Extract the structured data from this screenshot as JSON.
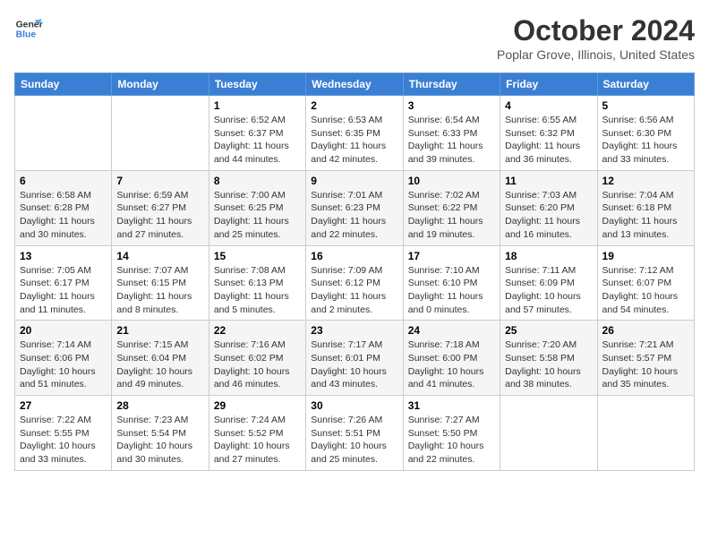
{
  "header": {
    "logo_line1": "General",
    "logo_line2": "Blue",
    "month": "October 2024",
    "location": "Poplar Grove, Illinois, United States"
  },
  "weekdays": [
    "Sunday",
    "Monday",
    "Tuesday",
    "Wednesday",
    "Thursday",
    "Friday",
    "Saturday"
  ],
  "weeks": [
    [
      {
        "day": "",
        "info": ""
      },
      {
        "day": "",
        "info": ""
      },
      {
        "day": "1",
        "info": "Sunrise: 6:52 AM\nSunset: 6:37 PM\nDaylight: 11 hours and 44 minutes."
      },
      {
        "day": "2",
        "info": "Sunrise: 6:53 AM\nSunset: 6:35 PM\nDaylight: 11 hours and 42 minutes."
      },
      {
        "day": "3",
        "info": "Sunrise: 6:54 AM\nSunset: 6:33 PM\nDaylight: 11 hours and 39 minutes."
      },
      {
        "day": "4",
        "info": "Sunrise: 6:55 AM\nSunset: 6:32 PM\nDaylight: 11 hours and 36 minutes."
      },
      {
        "day": "5",
        "info": "Sunrise: 6:56 AM\nSunset: 6:30 PM\nDaylight: 11 hours and 33 minutes."
      }
    ],
    [
      {
        "day": "6",
        "info": "Sunrise: 6:58 AM\nSunset: 6:28 PM\nDaylight: 11 hours and 30 minutes."
      },
      {
        "day": "7",
        "info": "Sunrise: 6:59 AM\nSunset: 6:27 PM\nDaylight: 11 hours and 27 minutes."
      },
      {
        "day": "8",
        "info": "Sunrise: 7:00 AM\nSunset: 6:25 PM\nDaylight: 11 hours and 25 minutes."
      },
      {
        "day": "9",
        "info": "Sunrise: 7:01 AM\nSunset: 6:23 PM\nDaylight: 11 hours and 22 minutes."
      },
      {
        "day": "10",
        "info": "Sunrise: 7:02 AM\nSunset: 6:22 PM\nDaylight: 11 hours and 19 minutes."
      },
      {
        "day": "11",
        "info": "Sunrise: 7:03 AM\nSunset: 6:20 PM\nDaylight: 11 hours and 16 minutes."
      },
      {
        "day": "12",
        "info": "Sunrise: 7:04 AM\nSunset: 6:18 PM\nDaylight: 11 hours and 13 minutes."
      }
    ],
    [
      {
        "day": "13",
        "info": "Sunrise: 7:05 AM\nSunset: 6:17 PM\nDaylight: 11 hours and 11 minutes."
      },
      {
        "day": "14",
        "info": "Sunrise: 7:07 AM\nSunset: 6:15 PM\nDaylight: 11 hours and 8 minutes."
      },
      {
        "day": "15",
        "info": "Sunrise: 7:08 AM\nSunset: 6:13 PM\nDaylight: 11 hours and 5 minutes."
      },
      {
        "day": "16",
        "info": "Sunrise: 7:09 AM\nSunset: 6:12 PM\nDaylight: 11 hours and 2 minutes."
      },
      {
        "day": "17",
        "info": "Sunrise: 7:10 AM\nSunset: 6:10 PM\nDaylight: 11 hours and 0 minutes."
      },
      {
        "day": "18",
        "info": "Sunrise: 7:11 AM\nSunset: 6:09 PM\nDaylight: 10 hours and 57 minutes."
      },
      {
        "day": "19",
        "info": "Sunrise: 7:12 AM\nSunset: 6:07 PM\nDaylight: 10 hours and 54 minutes."
      }
    ],
    [
      {
        "day": "20",
        "info": "Sunrise: 7:14 AM\nSunset: 6:06 PM\nDaylight: 10 hours and 51 minutes."
      },
      {
        "day": "21",
        "info": "Sunrise: 7:15 AM\nSunset: 6:04 PM\nDaylight: 10 hours and 49 minutes."
      },
      {
        "day": "22",
        "info": "Sunrise: 7:16 AM\nSunset: 6:02 PM\nDaylight: 10 hours and 46 minutes."
      },
      {
        "day": "23",
        "info": "Sunrise: 7:17 AM\nSunset: 6:01 PM\nDaylight: 10 hours and 43 minutes."
      },
      {
        "day": "24",
        "info": "Sunrise: 7:18 AM\nSunset: 6:00 PM\nDaylight: 10 hours and 41 minutes."
      },
      {
        "day": "25",
        "info": "Sunrise: 7:20 AM\nSunset: 5:58 PM\nDaylight: 10 hours and 38 minutes."
      },
      {
        "day": "26",
        "info": "Sunrise: 7:21 AM\nSunset: 5:57 PM\nDaylight: 10 hours and 35 minutes."
      }
    ],
    [
      {
        "day": "27",
        "info": "Sunrise: 7:22 AM\nSunset: 5:55 PM\nDaylight: 10 hours and 33 minutes."
      },
      {
        "day": "28",
        "info": "Sunrise: 7:23 AM\nSunset: 5:54 PM\nDaylight: 10 hours and 30 minutes."
      },
      {
        "day": "29",
        "info": "Sunrise: 7:24 AM\nSunset: 5:52 PM\nDaylight: 10 hours and 27 minutes."
      },
      {
        "day": "30",
        "info": "Sunrise: 7:26 AM\nSunset: 5:51 PM\nDaylight: 10 hours and 25 minutes."
      },
      {
        "day": "31",
        "info": "Sunrise: 7:27 AM\nSunset: 5:50 PM\nDaylight: 10 hours and 22 minutes."
      },
      {
        "day": "",
        "info": ""
      },
      {
        "day": "",
        "info": ""
      }
    ]
  ]
}
